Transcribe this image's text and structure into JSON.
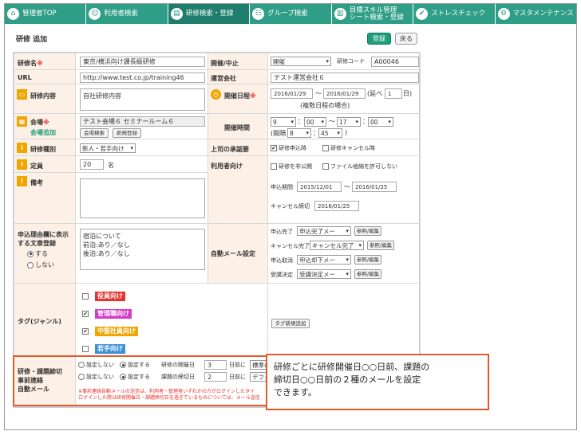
{
  "nav": [
    {
      "label": "管理者TOP",
      "icon": "home-icon",
      "glyph": "⌂"
    },
    {
      "label": "利用者検索",
      "icon": "users-icon",
      "glyph": "☺"
    },
    {
      "label": "研修検索・登録",
      "icon": "training-icon",
      "glyph": "▤"
    },
    {
      "label": "グループ検索",
      "icon": "group-icon",
      "glyph": "☷"
    },
    {
      "label": "目標スキル管理\nシート検索・登録",
      "icon": "sheet-icon",
      "glyph": "▥"
    },
    {
      "label": "ストレスチェック",
      "icon": "check-icon",
      "glyph": "✔"
    },
    {
      "label": "マスタメンテナンス",
      "icon": "gear-icon",
      "glyph": "⚙"
    }
  ],
  "page_title": "研修 追加",
  "buttons": {
    "register": "登録",
    "back": "戻る"
  },
  "form": {
    "name_label": "研修名",
    "name_value": "東京/横浜向け課長級研修",
    "open_label": "開催/中止",
    "open_value": "開催",
    "code_label": "研修コード",
    "code_value": "A00046",
    "url_label": "URL",
    "url_value": "http://www.test.co.jp/training46",
    "company_label": "運営会社",
    "company_value": "テスト運営会社６",
    "content_label": "研修内容",
    "content_value": "自社研修内容",
    "date_label": "開催日程",
    "date_from": "2016/01/29",
    "tilde": "〜",
    "date_to": "2016/01/29",
    "days_prefix": "(延べ",
    "days_value": "1",
    "days_suffix": "日)",
    "date_note": "(複数日程の場合)",
    "venue_label": "会場",
    "venue_value": "テスト会場６ セミナールーム６",
    "venue_add": "会場追加",
    "venue_search_btn": "会場検索",
    "new_btn": "新規登録",
    "time_label": "開催時間",
    "time_h1": "9",
    "time_m1": "00",
    "time_h2": "17",
    "time_m2": "00",
    "interval_prefix": "(間隔",
    "interval_h": "8",
    "interval_m": "45",
    "interval_suffix": ")",
    "kind_label": "研修種別",
    "kind_value": "新人・若手向け",
    "approval_label": "上司の承認要",
    "approval_apply": "研修申込時",
    "approval_cancel": "研修キャンセル時",
    "capacity_label": "定員",
    "capacity_value": "20",
    "capacity_unit": "名",
    "user_label": "利用者向け",
    "hide_label": "研修を非公開",
    "file_label": "ファイル格納を許可しない",
    "apply_period_label": "申込期間",
    "apply_from": "2015/12/01",
    "apply_to": "2016/01/25",
    "cancel_deadline_label": "キャンセル締切",
    "cancel_deadline_value": "2016/01/25",
    "memo_label": "備考",
    "reason_label": "申込理由欄に表示\nする文章登録",
    "reason_yes": "する",
    "reason_no": "しない",
    "reason_value": "宿泊について\n前泊:あり／なし\n後泊:あり／なし",
    "automail_label": "自動メール設定",
    "mail_rows": [
      {
        "label": "申込完了",
        "value": "申込完了メー",
        "btn": "参照/編集"
      },
      {
        "label": "キャンセル完了",
        "value": "キャンセル完了",
        "btn": "参照/編集"
      },
      {
        "label": "申込取消",
        "value": "申込却下メー",
        "btn": "参照/編集"
      },
      {
        "label": "受講決定",
        "value": "受講決定メー",
        "btn": "参照/編集"
      }
    ],
    "tag_label": "タグ(ジャンル)",
    "tags": [
      {
        "label": "役員向け",
        "color": "#e8312a",
        "checked": false
      },
      {
        "label": "管理職向け",
        "color": "#d63bc8",
        "checked": true
      },
      {
        "label": "中堅社員向け",
        "color": "#f0a500",
        "checked": true
      },
      {
        "label": "若手向け",
        "color": "#3a8fd8",
        "checked": false
      }
    ],
    "tag_new_btn": "タグ新規追加",
    "deadline_label": "研修・課題締切\n事前連絡\n自動メール",
    "deadline_rows": [
      {
        "off": "設定しない",
        "on": "設定する",
        "what": "研修の開催日",
        "days": "3",
        "suffix": "日前に",
        "select": "標準の"
      },
      {
        "off": "設定しない",
        "on": "設定する",
        "what": "課題の締切日",
        "days": "2",
        "suffix": "日前に",
        "select": "デフォ"
      }
    ],
    "deadline_note1": "※事前連絡自動メールの送信は、利用者・管理者いずれかの方がログインしたタイ",
    "deadline_note2": "ログインした際は研修開催日・課題締切日を過ぎているものについては、メール送信"
  },
  "callout": "研修ごとに研修開催日○○日前、課題の\n締切日○○日前の２種のメールを設定\nできます。"
}
